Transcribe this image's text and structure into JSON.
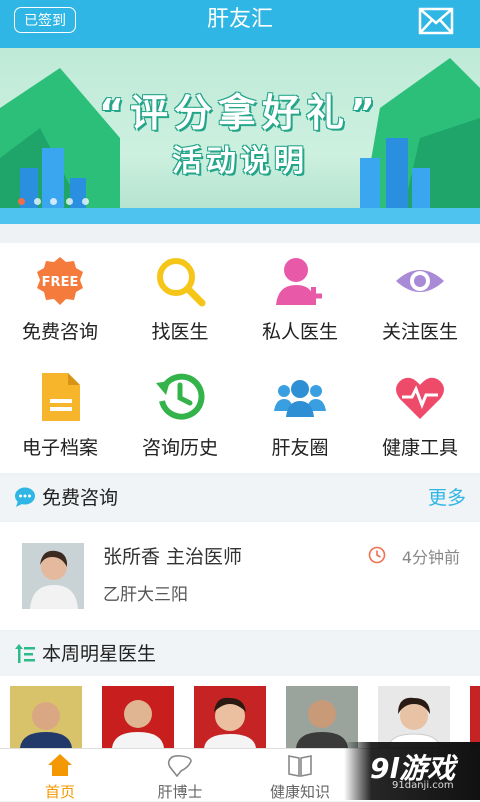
{
  "header": {
    "signed_label": "已签到",
    "title": "肝友汇"
  },
  "banner": {
    "line1": "“评分拿好礼”",
    "line2": "活动说明",
    "dot_count": 5,
    "active_dot": 0
  },
  "grid": [
    {
      "label": "免费咨询",
      "icon": "free-icon",
      "badge": "FREE"
    },
    {
      "label": "找医生",
      "icon": "magnifier-icon"
    },
    {
      "label": "私人医生",
      "icon": "add-person-icon"
    },
    {
      "label": "关注医生",
      "icon": "eye-icon"
    },
    {
      "label": "电子档案",
      "icon": "document-icon"
    },
    {
      "label": "咨询历史",
      "icon": "history-clock-icon"
    },
    {
      "label": "肝友圈",
      "icon": "group-icon"
    },
    {
      "label": "健康工具",
      "icon": "heart-pulse-icon"
    }
  ],
  "consult_section": {
    "title": "免费咨询",
    "more": "更多"
  },
  "consult_card": {
    "doctor": "张所香 主治医师",
    "disease": "乙肝大三阳",
    "time": "4分钟前"
  },
  "stars_section": {
    "title": "本周明星医生"
  },
  "nav": [
    {
      "label": "首页",
      "icon": "home-icon",
      "active": true
    },
    {
      "label": "肝博士",
      "icon": "liver-icon",
      "active": false
    },
    {
      "label": "健康知识",
      "icon": "book-icon",
      "active": false
    }
  ],
  "watermark": {
    "text": "9l游戏",
    "sub": "91danji.com"
  },
  "colors": {
    "primary": "#2fb6e4",
    "accent": "#f39800"
  }
}
